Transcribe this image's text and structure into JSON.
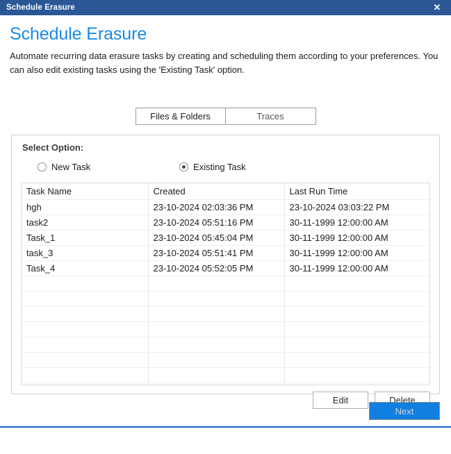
{
  "window": {
    "title": "Schedule Erasure",
    "close_icon": "close-icon",
    "close_glyph": "✕"
  },
  "header": {
    "title": "Schedule Erasure",
    "subtitle": "Automate recurring data erasure tasks by creating and scheduling them according to your preferences. You can also edit existing tasks using the 'Existing Task' option."
  },
  "tabs": {
    "selected": "Files & Folders",
    "items": [
      {
        "label": "Files & Folders"
      },
      {
        "label": "Traces"
      }
    ]
  },
  "options_group": {
    "legend": "Select Option:",
    "radios": [
      {
        "label": "New Task",
        "checked": false
      },
      {
        "label": "Existing Task",
        "checked": true
      }
    ]
  },
  "table": {
    "columns": [
      "Task Name",
      "Created",
      "Last Run Time"
    ],
    "rows": [
      {
        "name": "hgh",
        "created": "23-10-2024 02:03:36 PM",
        "last_run": "23-10-2024 03:03:22 PM"
      },
      {
        "name": "task2",
        "created": "23-10-2024 05:51:16 PM",
        "last_run": "30-11-1999 12:00:00 AM"
      },
      {
        "name": "Task_1",
        "created": "23-10-2024 05:45:04 PM",
        "last_run": "30-11-1999 12:00:00 AM"
      },
      {
        "name": "task_3",
        "created": "23-10-2024 05:51:41 PM",
        "last_run": "30-11-1999 12:00:00 AM"
      },
      {
        "name": "Task_4",
        "created": "23-10-2024 05:52:05 PM",
        "last_run": "30-11-1999 12:00:00 AM"
      }
    ],
    "empty_row_count": 9
  },
  "actions": {
    "edit_label": "Edit",
    "delete_label": "Delete",
    "next_label": "Next"
  },
  "colors": {
    "titlebar": "#2b5797",
    "accent_heading": "#1a8ae5",
    "next_button": "#117fe0",
    "bottom_rule": "#1565c0"
  }
}
